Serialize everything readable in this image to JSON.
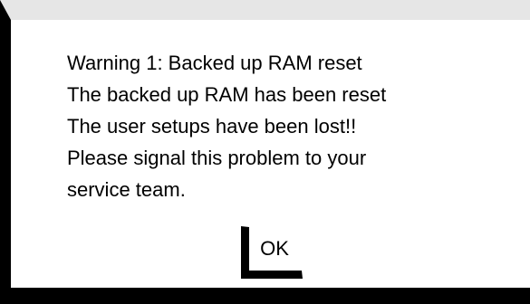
{
  "dialog": {
    "message_lines": [
      "Warning 1: Backed up RAM reset",
      "The backed up RAM has been reset",
      "The user setups have been lost!!",
      "Please signal this problem to your",
      "service team."
    ],
    "ok_label": "OK"
  },
  "colors": {
    "background": "#ffffff",
    "frame_shadow": "#000000",
    "top_strip": "#e6e6e6"
  }
}
